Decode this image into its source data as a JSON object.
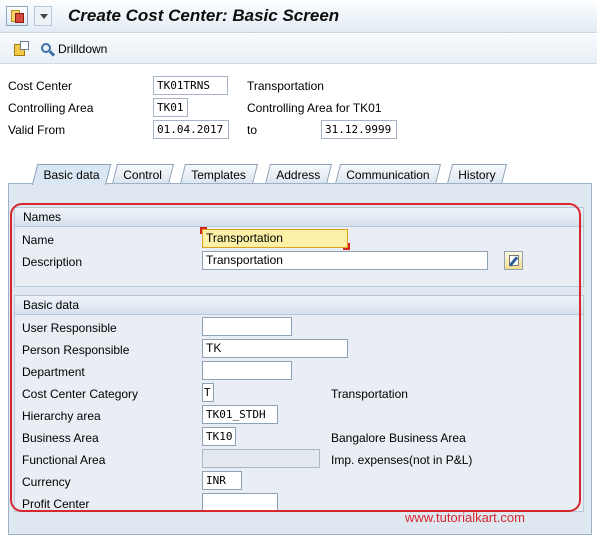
{
  "window": {
    "title": "Create Cost Center: Basic Screen"
  },
  "toolbar": {
    "drilldown_label": "Drilldown"
  },
  "header": {
    "cost_center": {
      "label": "Cost Center",
      "value": "TK01TRNS",
      "text": "Transportation"
    },
    "controlling_area": {
      "label": "Controlling Area",
      "value": "TK01",
      "text": "Controlling Area for TK01"
    },
    "valid_from": {
      "label": "Valid From",
      "value": "01.04.2017",
      "to_label": "to",
      "to_value": "31.12.9999"
    }
  },
  "tabs": [
    {
      "label": "Basic data",
      "active": true
    },
    {
      "label": "Control"
    },
    {
      "label": "Templates"
    },
    {
      "label": "Address"
    },
    {
      "label": "Communication"
    },
    {
      "label": "History"
    }
  ],
  "names_group": {
    "title": "Names",
    "name": {
      "label": "Name",
      "value": "Transportation"
    },
    "description": {
      "label": "Description",
      "value": "Transportation"
    }
  },
  "basic_group": {
    "title": "Basic data",
    "user_responsible": {
      "label": "User Responsible",
      "value": ""
    },
    "person_responsible": {
      "label": "Person Responsible",
      "value": "TK"
    },
    "department": {
      "label": "Department",
      "value": ""
    },
    "category": {
      "label": "Cost Center Category",
      "value": "T",
      "text": "Transportation"
    },
    "hierarchy_area": {
      "label": "Hierarchy area",
      "value": "TK01_STDH"
    },
    "business_area": {
      "label": "Business Area",
      "value": "TK10",
      "text": "Bangalore Business Area"
    },
    "functional_area": {
      "label": "Functional Area",
      "value": "",
      "text": "Imp. expenses(not in P&L)"
    },
    "currency": {
      "label": "Currency",
      "value": "INR"
    },
    "profit_center": {
      "label": "Profit Center",
      "value": ""
    }
  },
  "watermark": "www.tutorialkart.com",
  "colors": {
    "highlight": "#d8262e",
    "focus_field": "#fdf1a8"
  }
}
